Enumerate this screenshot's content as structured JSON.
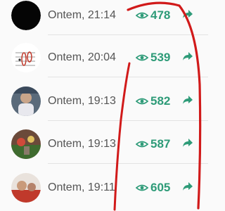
{
  "colors": {
    "accent": "#2e9b78",
    "time_text": "#555555",
    "annotation": "#d11a1a"
  },
  "icons": {
    "views": "eye-icon",
    "share": "share-arrow-icon"
  },
  "status_items": [
    {
      "time": "Ontem, 21:14",
      "views": "478"
    },
    {
      "time": "Ontem, 20:04",
      "views": "539"
    },
    {
      "time": "Ontem, 19:13",
      "views": "582"
    },
    {
      "time": "Ontem, 19:13",
      "views": "587"
    },
    {
      "time": "Ontem, 19:11",
      "views": "605"
    }
  ]
}
